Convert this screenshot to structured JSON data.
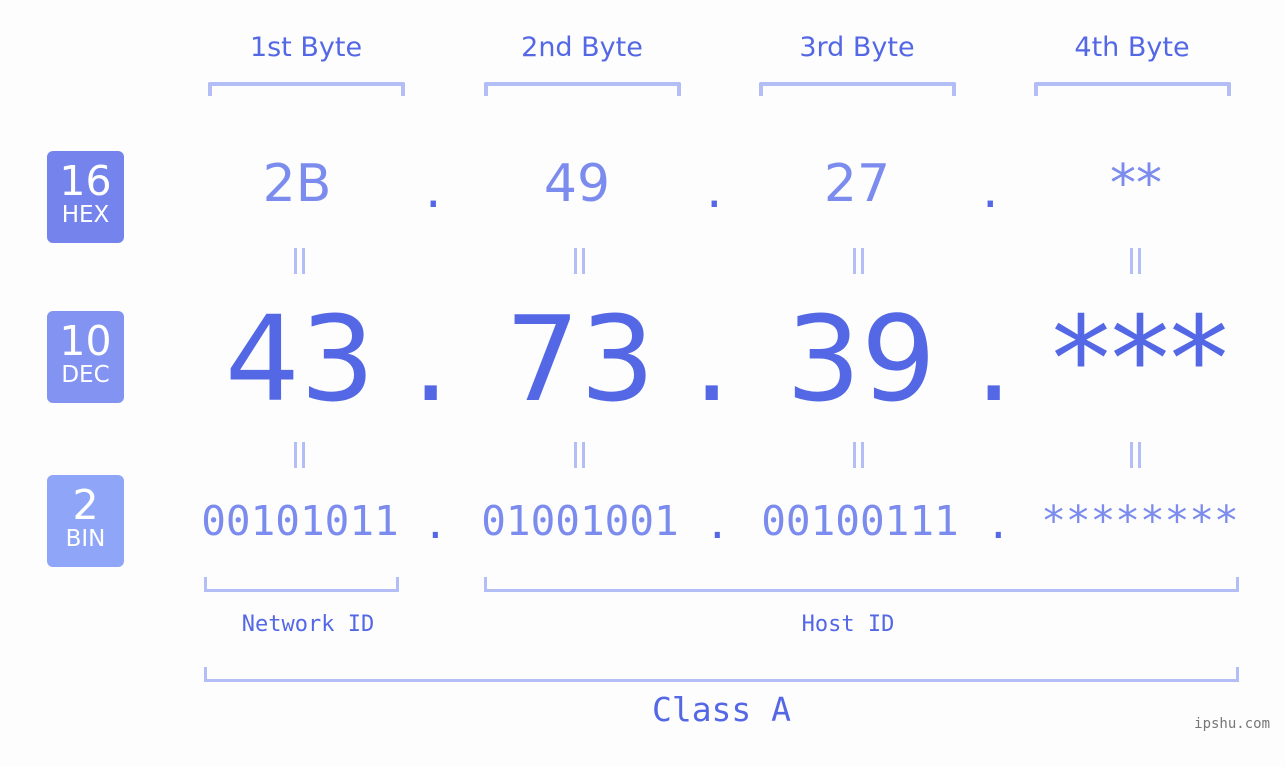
{
  "bytes": [
    {
      "label": "1st Byte",
      "hex": "2B",
      "dec": "43",
      "bin": "00101011"
    },
    {
      "label": "2nd Byte",
      "hex": "49",
      "dec": "73",
      "bin": "01001001"
    },
    {
      "label": "3rd Byte",
      "hex": "27",
      "dec": "39",
      "bin": "00100111"
    },
    {
      "label": "4th Byte",
      "hex": "**",
      "dec": "***",
      "bin": "********"
    }
  ],
  "separator": ".",
  "badges": {
    "hex": {
      "num": "16",
      "label": "HEX",
      "color": "#7584ec"
    },
    "dec": {
      "num": "10",
      "label": "DEC",
      "color": "#8393f2"
    },
    "bin": {
      "num": "2",
      "label": "BIN",
      "color": "#8fa5f8"
    }
  },
  "segments": {
    "network": "Network ID",
    "host": "Host ID",
    "class": "Class A"
  },
  "watermark": "ipshu.com",
  "colors": {
    "accent": "#5468e6",
    "light": "#7b8cee",
    "bracket": "#b3bdf6"
  }
}
